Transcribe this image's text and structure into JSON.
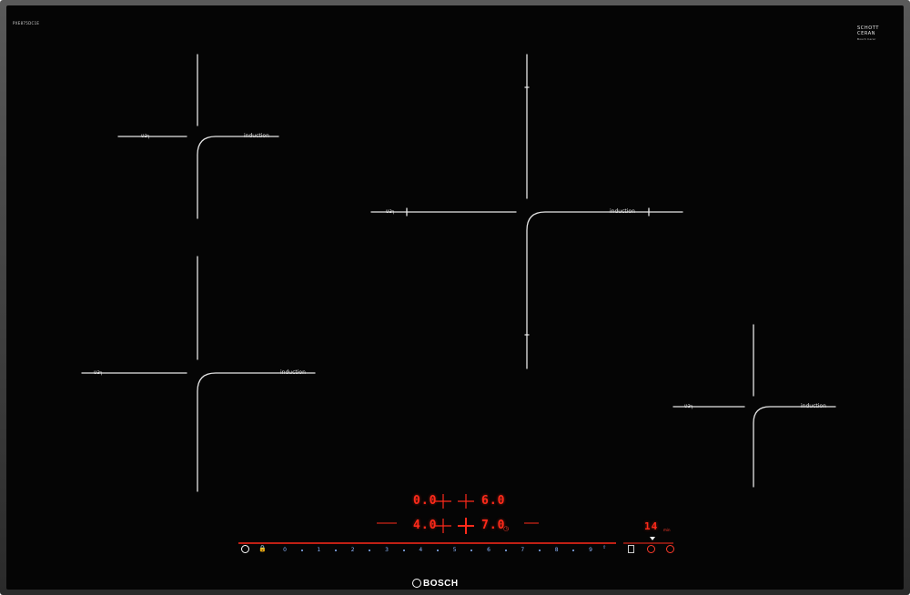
{
  "product": {
    "model": "PXE875DC1E",
    "glass_brand": "SCHOTT",
    "glass_line": "CERAN",
    "glass_sub": "Bosch Cerar",
    "brand": "BOSCH"
  },
  "zones": [
    {
      "label": "induction",
      "pictogram": "ʋɜ┐"
    },
    {
      "label": "induction",
      "pictogram": "ʋɜ┐"
    },
    {
      "label": "induction",
      "pictogram": "ʋɜ┐"
    },
    {
      "label": "induction",
      "pictogram": "ʋɜ┐"
    }
  ],
  "displays": {
    "top_left": "0.0",
    "top_right": "6.0",
    "bottom_left": "4.0",
    "bottom_right": "7.0",
    "timer": "14",
    "timer_unit": "min"
  },
  "controls": {
    "power_icon": "power-icon",
    "child_lock_icon": "child-lock-icon",
    "slider": [
      "0",
      "1",
      "2",
      "3",
      "4",
      "5",
      "6",
      "7",
      "8",
      "9"
    ],
    "boost_icon": "boost-icon",
    "memory_icon": "memory-icon",
    "timer_icon": "timer-icon",
    "clock_icon": "clock-icon"
  },
  "colors": {
    "display_red": "#ff2a1a",
    "slider_blue": "#8fb8ff",
    "glass": "#050505"
  }
}
